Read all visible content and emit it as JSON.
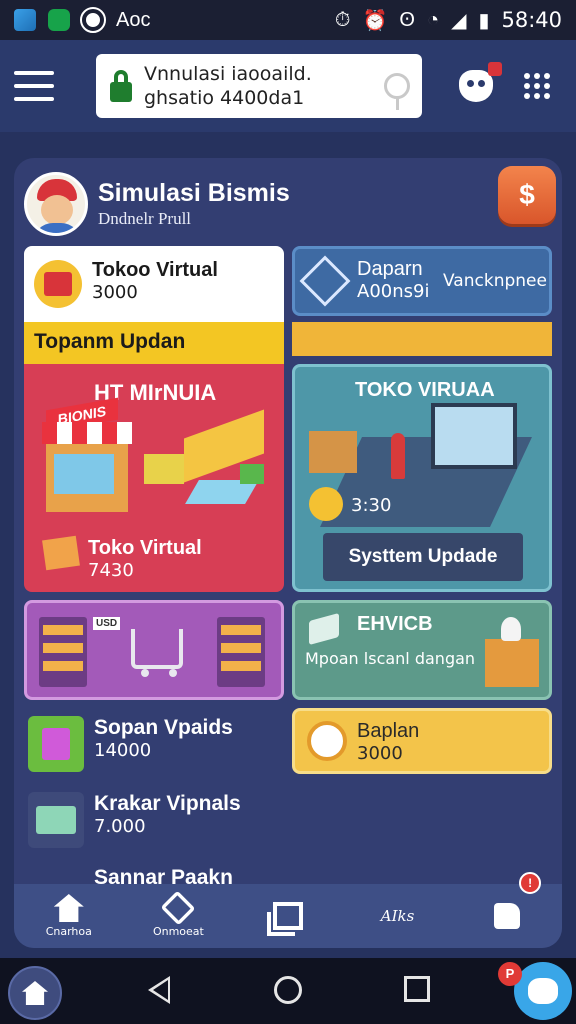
{
  "status_bar": {
    "left_text": "Aoc",
    "time": "58:40",
    "icons": [
      "gallery-icon",
      "whatsapp-icon",
      "play-icon",
      "alarm-icon",
      "alarm-icon",
      "vibrate-icon",
      "wifi-icon",
      "signal-icon",
      "battery-icon"
    ]
  },
  "top_bar": {
    "search_line1": "Vnnulasi iaooaild.",
    "search_line2": "ghsatio 4400da1"
  },
  "profile": {
    "title": "Simulasi Bismis",
    "subtitle": "Dndnelr Prull",
    "coin_symbol": "$"
  },
  "cards": {
    "toko_top": {
      "title": "Tokoo Virtual",
      "value": "3000"
    },
    "banner_yellow": "Topanm Updan",
    "bisnis": {
      "sign": "BIONIS",
      "label": "HT MIrNUIA",
      "title": "Toko Virtual",
      "value": "7430"
    },
    "dapan": {
      "title": "Daparn",
      "value": "A00ns9i",
      "side": "Vancknpnee"
    },
    "toko_virtual": {
      "label": "TOKO VIRUAA",
      "value": "3:30",
      "button": "Systtem Updade"
    },
    "shop_sign": "USD",
    "ehvicb": {
      "title": "EHVICB",
      "subtitle": "Mpoan lscanl dangan"
    },
    "list": [
      {
        "title": "Sopan Vpaids",
        "value": "14000"
      },
      {
        "title": "Krakar Vipnals",
        "value": "7.000"
      },
      {
        "title": "Sannar Paakn",
        "value": ""
      }
    ],
    "bandan": {
      "title": "Baplan",
      "value": "3000"
    }
  },
  "bottom_nav": [
    {
      "label": "Cnarhoa",
      "icon": "star-hand-icon"
    },
    {
      "label": "Onmoeat",
      "icon": "cube-icon"
    },
    {
      "label": "",
      "icon": "window-icon"
    },
    {
      "label": "AIks",
      "icon": ""
    },
    {
      "label": "",
      "icon": "thumbs-up-icon",
      "badge": "!"
    }
  ],
  "system_nav": {
    "assistant_badge": "P"
  }
}
